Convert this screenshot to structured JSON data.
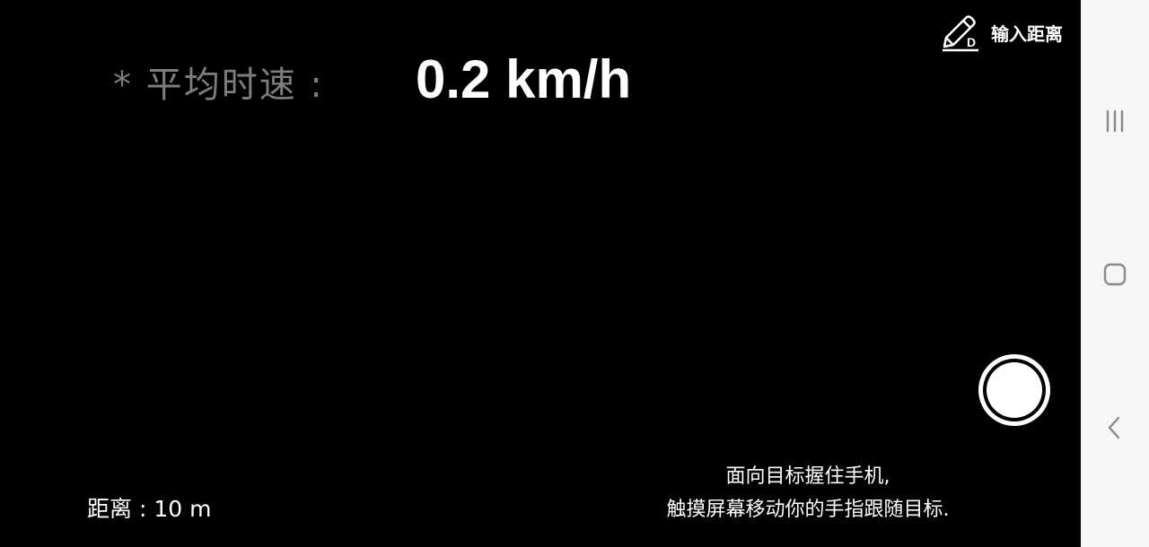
{
  "stats": {
    "avg_speed_label": "* 平均时速 :",
    "avg_speed_value": "0.2 km/h"
  },
  "header": {
    "input_distance_label": "输入距离",
    "input_distance_icon": "pencil-d-icon"
  },
  "footer": {
    "distance_readout": "距离 : 10 m",
    "instruction_line1": "面向目标握住手机,",
    "instruction_line2": "触摸屏幕移动你的手指跟随目标."
  },
  "nav": {
    "recents_icon": "recents-icon",
    "home_icon": "home-icon",
    "back_icon": "back-icon"
  },
  "colors": {
    "background": "#000000",
    "label_gray": "#7d7d7d",
    "text_white": "#ffffff",
    "nav_bar": "#f6f6f6",
    "nav_icon": "#8a8a8a"
  }
}
